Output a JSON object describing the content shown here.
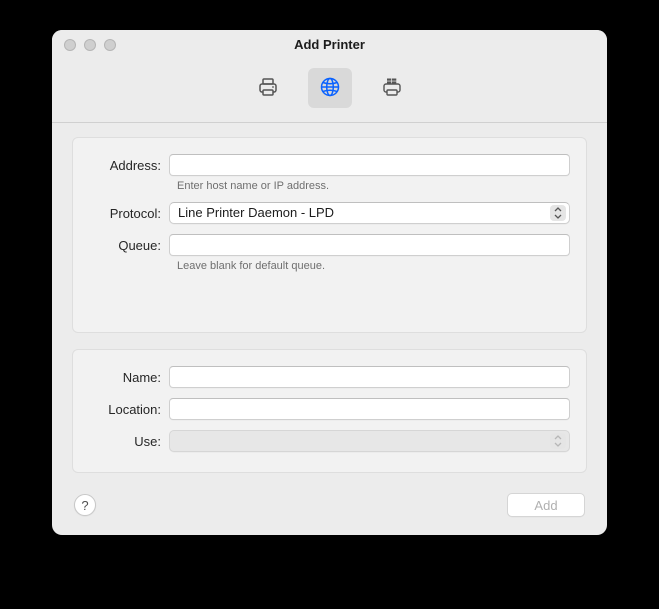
{
  "window": {
    "title": "Add Printer"
  },
  "tabs": {
    "default": "default-printer",
    "ip": "ip-printer",
    "windows": "windows-printer",
    "selected": "ip"
  },
  "form": {
    "labels": {
      "address": "Address:",
      "protocol": "Protocol:",
      "queue": "Queue:",
      "name": "Name:",
      "location": "Location:",
      "use": "Use:"
    },
    "hints": {
      "address": "Enter host name or IP address.",
      "queue": "Leave blank for default queue."
    },
    "values": {
      "address": "",
      "protocol": "Line Printer Daemon - LPD",
      "queue": "",
      "name": "",
      "location": "",
      "use": ""
    }
  },
  "footer": {
    "help": "?",
    "add": "Add"
  }
}
